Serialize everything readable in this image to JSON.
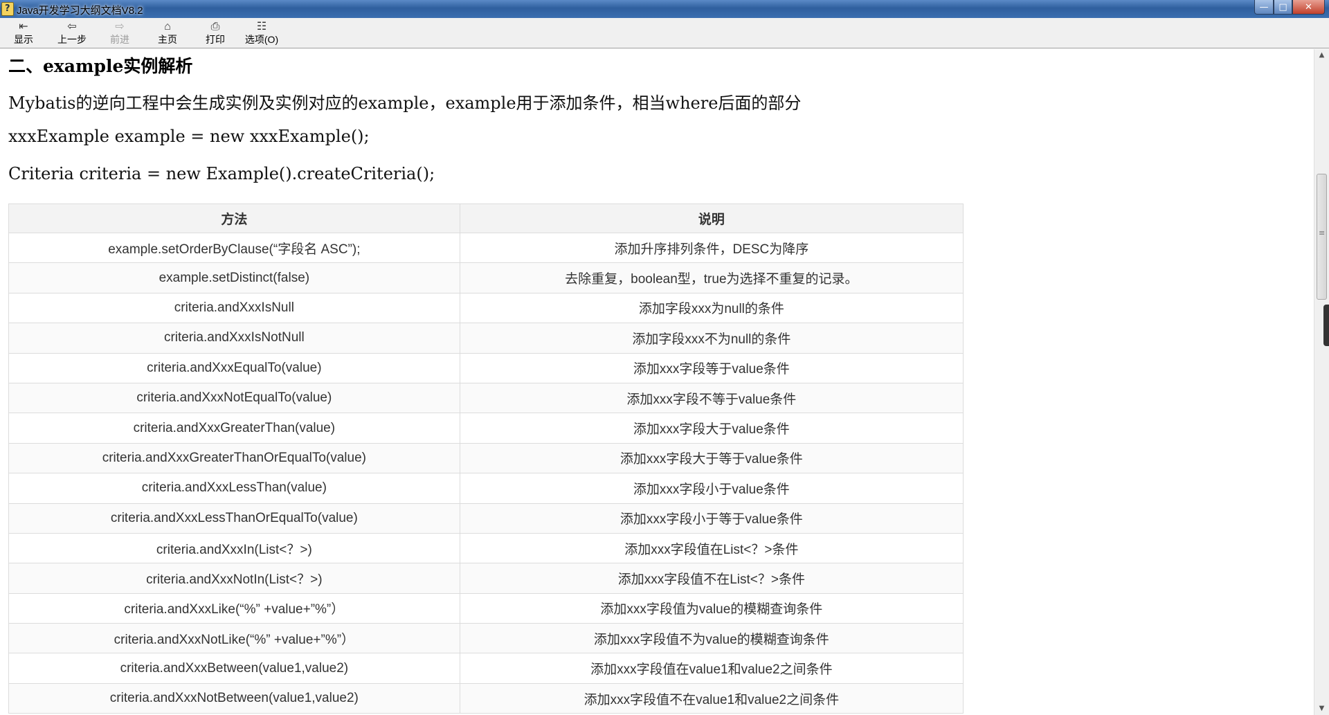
{
  "window": {
    "title": "Java开发学习大纲文档V8.2",
    "minimize": "—",
    "maximize": "□",
    "close": "✕"
  },
  "toolbar": {
    "items": [
      {
        "label": "显示",
        "icon": "show-icon",
        "glyph": "⇤",
        "enabled": true
      },
      {
        "label": "上一步",
        "icon": "back-icon",
        "glyph": "⇦",
        "enabled": true
      },
      {
        "label": "前进",
        "icon": "forward-icon",
        "glyph": "⇨",
        "enabled": false
      },
      {
        "label": "主页",
        "icon": "home-icon",
        "glyph": "⌂",
        "enabled": true
      },
      {
        "label": "打印",
        "icon": "print-icon",
        "glyph": "⎙",
        "enabled": true
      },
      {
        "label": "选项(O)",
        "icon": "options-icon",
        "glyph": "☷",
        "enabled": true
      }
    ]
  },
  "content": {
    "heading": "二、example实例解析",
    "para1": "Mybatis的逆向工程中会生成实例及实例对应的example，example用于添加条件，相当where后面的部分",
    "para2": "xxxExample example = new xxxExample();",
    "para3": "Criteria criteria = new Example().createCriteria();",
    "table": {
      "headers": [
        "方法",
        "说明"
      ],
      "rows": [
        [
          "example.setOrderByClause(“字段名 ASC”);",
          "添加升序排列条件，DESC为降序"
        ],
        [
          "example.setDistinct(false)",
          "去除重复，boolean型，true为选择不重复的记录。"
        ],
        [
          "criteria.andXxxIsNull",
          "添加字段xxx为null的条件"
        ],
        [
          "criteria.andXxxIsNotNull",
          "添加字段xxx不为null的条件"
        ],
        [
          "criteria.andXxxEqualTo(value)",
          "添加xxx字段等于value条件"
        ],
        [
          "criteria.andXxxNotEqualTo(value)",
          "添加xxx字段不等于value条件"
        ],
        [
          "criteria.andXxxGreaterThan(value)",
          "添加xxx字段大于value条件"
        ],
        [
          "criteria.andXxxGreaterThanOrEqualTo(value)",
          "添加xxx字段大于等于value条件"
        ],
        [
          "criteria.andXxxLessThan(value)",
          "添加xxx字段小于value条件"
        ],
        [
          "criteria.andXxxLessThanOrEqualTo(value)",
          "添加xxx字段小于等于value条件"
        ],
        [
          "criteria.andXxxIn(List<？>)",
          "添加xxx字段值在List<？>条件"
        ],
        [
          "criteria.andXxxNotIn(List<？>)",
          "添加xxx字段值不在List<？>条件"
        ],
        [
          "criteria.andXxxLike(“%” +value+”%”）",
          "添加xxx字段值为value的模糊查询条件"
        ],
        [
          "criteria.andXxxNotLike(“%” +value+”%”）",
          "添加xxx字段值不为value的模糊查询条件"
        ],
        [
          "criteria.andXxxBetween(value1,value2)",
          "添加xxx字段值在value1和value2之间条件"
        ],
        [
          "criteria.andXxxNotBetween(value1,value2)",
          "添加xxx字段值不在value1和value2之间条件"
        ]
      ]
    }
  },
  "scrollbar": {
    "up": "▲",
    "down": "▼"
  }
}
